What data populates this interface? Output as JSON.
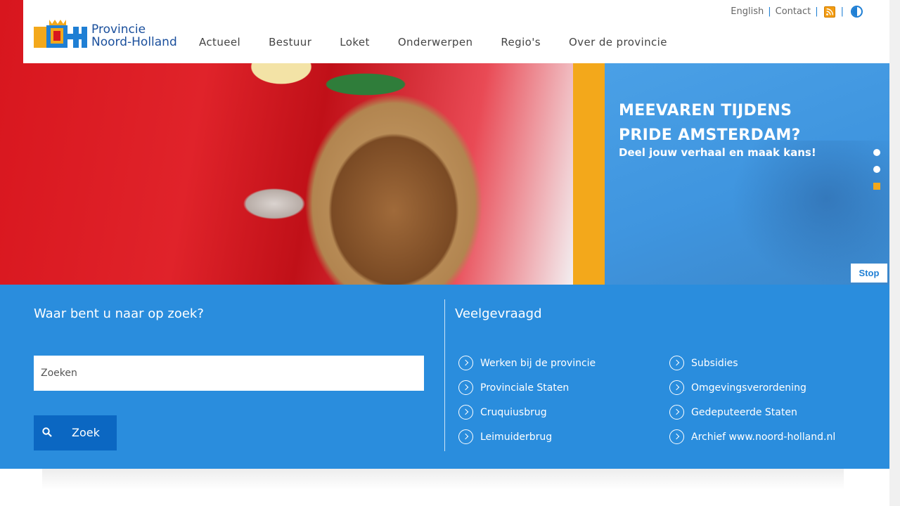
{
  "header": {
    "logo": {
      "line1": "Provincie",
      "line2": "Noord-Holland",
      "mark_letters": "NH",
      "mark_colors": [
        "#f3a81b",
        "#1f7fd4",
        "#d8161e"
      ]
    },
    "nav": [
      "Actueel",
      "Bestuur",
      "Loket",
      "Onderwerpen",
      "Regio's",
      "Over de provincie"
    ],
    "utility": {
      "english": "English",
      "contact": "Contact",
      "rss_icon": "rss-icon",
      "contrast_icon": "contrast-icon"
    }
  },
  "hero": {
    "title": "MEEVAREN TIJDENS PRIDE AMSTERDAM?",
    "subtitle": "Deel jouw verhaal en maak kans!",
    "slides_total": 3,
    "active_slide": 3,
    "stop_label": "Stop",
    "colors": {
      "accent": "#f3a81b",
      "panel": "#4aa0e6"
    }
  },
  "search": {
    "title": "Waar bent u naar op zoek?",
    "placeholder": "Zoeken",
    "button_label": "Zoek",
    "button_icon": "search-icon"
  },
  "faq": {
    "title": "Veelgevraagd",
    "items": [
      "Werken bij de provincie",
      "Subsidies",
      "Provinciale Staten",
      "Omgevingsverordening",
      "Cruquiusbrug",
      "Gedeputeerde Staten",
      "Leimuiderbrug",
      "Archief www.noord-holland.nl"
    ]
  },
  "colors": {
    "band": "#2a8ddd",
    "button": "#0b67c2",
    "brand_blue": "#1a4f9c"
  }
}
